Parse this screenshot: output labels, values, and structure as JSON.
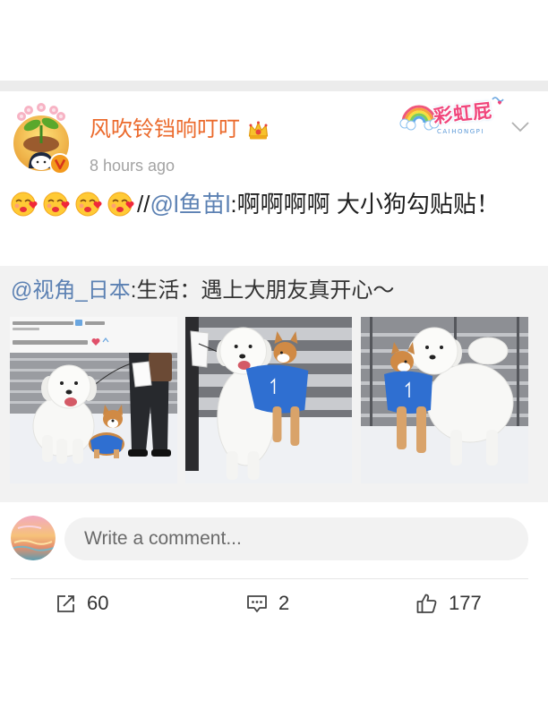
{
  "colors": {
    "username": "#eb6a2c",
    "link": "#5c81b3",
    "separator_band": "#ececec",
    "repost_background": "#f2f2f2",
    "verified_badge": "#f39a1e",
    "badge_title": "#f0467c"
  },
  "post": {
    "author": {
      "name": "风吹铃铛响叮叮",
      "avatar_icon": "sprout-character-avatar",
      "verified_icon": "verified-badge-icon",
      "vip_icon": "crown-icon"
    },
    "time": "8 hours ago",
    "badge": {
      "title": "彩虹屁",
      "subtitle": "CAIHONGPI",
      "icon": "rainbow-icon"
    },
    "menu_icon": "chevron-down-icon",
    "text": {
      "emojis": [
        "kissing-heart-emoji",
        "kissing-heart-emoji",
        "kissing-heart-emoji",
        "kissing-heart-emoji"
      ],
      "prefix": "//",
      "mention": "@l鱼苗l",
      "body": ":啊啊啊啊 大小狗勾贴贴！"
    },
    "repost": {
      "mention": "@视角_日本",
      "body": ":生活：遇上大朋友真开心～"
    }
  },
  "comment": {
    "avatar_icon": "sunset-painting-avatar",
    "placeholder": "Write a comment..."
  },
  "actions": {
    "repost": {
      "icon": "repost-icon",
      "count": "60"
    },
    "comment": {
      "icon": "comment-icon",
      "count": "2"
    },
    "like": {
      "icon": "like-icon",
      "count": "177"
    }
  }
}
